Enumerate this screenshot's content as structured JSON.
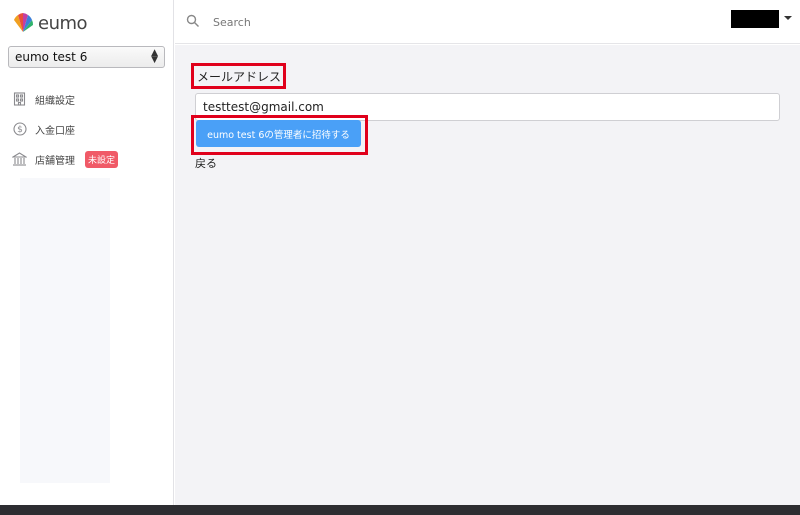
{
  "app": {
    "logo_text": "eumo"
  },
  "sidebar": {
    "org_select": {
      "value": "eumo test 6"
    },
    "items": [
      {
        "label": "組織設定",
        "icon": "building-icon"
      },
      {
        "label": "入金口座",
        "icon": "dollar-circle-icon"
      },
      {
        "label": "店舗管理",
        "icon": "store-icon",
        "badge": "未設定"
      }
    ]
  },
  "header": {
    "search_placeholder": "Search"
  },
  "form": {
    "email_label": "メールアドレス",
    "email_value": "testtest@gmail.com",
    "invite_button": "eumo test 6の管理者に招待する",
    "back_link": "戻る"
  },
  "colors": {
    "accent": "#4aa0f7",
    "badge": "#f05a67",
    "highlight": "#e0001b"
  }
}
